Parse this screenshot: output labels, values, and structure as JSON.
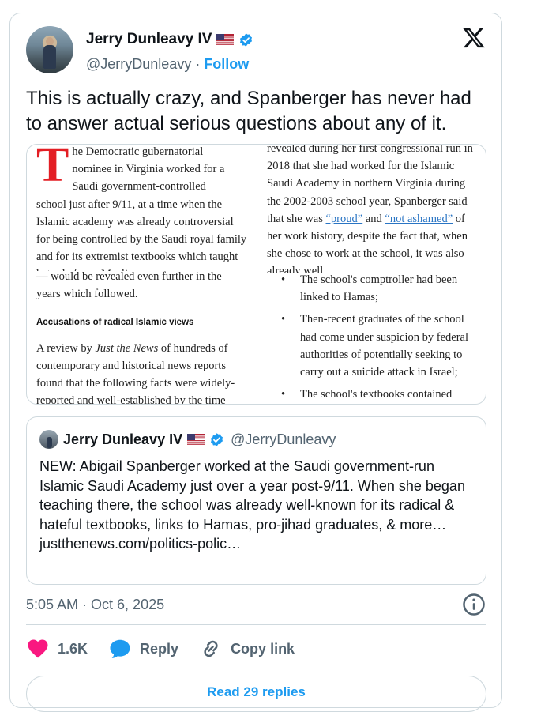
{
  "author": {
    "name": "Jerry Dunleavy IV",
    "handle": "@JerryDunleavy",
    "follow_label": "Follow",
    "separator": "·"
  },
  "tweet": {
    "text": "This is actually crazy, and Spanberger has never had to answer actual serious questions about any of it."
  },
  "article": {
    "col1_dropcap": "T",
    "col1_first": "he Democratic gubernatorial",
    "col1_second": "nominee in Virginia worked for a",
    "col1_third": "Saudi government-controlled",
    "col1_rest": "school just after 9/11, at a time when the Islamic academy was already controversial for being controlled by the Saudi royal family and for its extremist textbooks which taught hatred of non-Muslims",
    "col2_a": "revealed during her first congressional run in 2018 that she had worked for the Islamic Saudi Academy in northern Virginia during the 2002-2003 school year, Spanberger said that she was ",
    "col2_link1": "“proud”",
    "col2_b": " and ",
    "col2_link2": "“not ashamed”",
    "col2_c": " of her work history, despite the fact that, when she chose to work at the school, it was also already well",
    "col3_text": "— would be revealed even further in the years which followed.",
    "col3_subhead": "Accusations of radical Islamic views",
    "col3_body_a": "A review by ",
    "col3_body_em": "Just the News",
    "col3_body_b": " of hundreds of contemporary and historical news reports found that the following facts were widely-reported and well-established by the time",
    "col4_bullets": [
      "The school's comptroller had been linked to Hamas;",
      "Then-recent graduates of the school had come under suspicion by federal authorities of potentially seeking to carry out a suicide attack in Israel;",
      "The school's textbooks contained hateful language, including animosity"
    ]
  },
  "quote": {
    "name": "Jerry Dunleavy IV",
    "handle": "@JerryDunleavy",
    "text": "NEW: Abigail Spanberger worked at the Saudi government-run Islamic Saudi Academy just over a year post-9/11. When she began teaching there, the school was already well-known for its radical & hateful textbooks, links to Hamas, pro-jihad graduates, & more…",
    "link": "justthenews.com/politics-polic…"
  },
  "timestamp": "5:05 AM · Oct 6, 2025",
  "actions": {
    "likes": "1.6K",
    "reply_label": "Reply",
    "copy_label": "Copy link"
  },
  "replies_button": "Read 29 replies",
  "colors": {
    "brand_blue": "#1d9bf0",
    "like_red": "#f91880",
    "text_secondary": "#536471",
    "border": "#cfd9de"
  },
  "icons": [
    "x-logo-icon",
    "verified-icon",
    "us-flag-icon",
    "heart-icon",
    "reply-icon",
    "link-icon",
    "info-icon"
  ]
}
